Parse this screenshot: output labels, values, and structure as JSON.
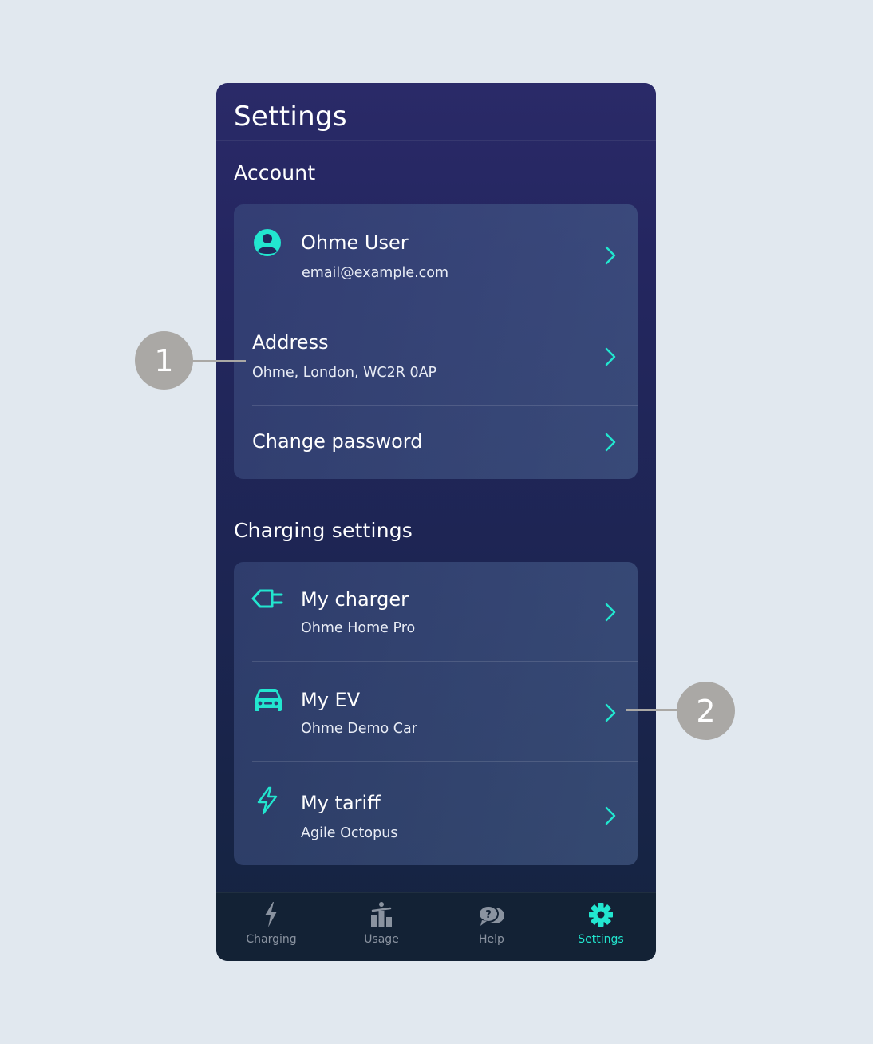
{
  "header": {
    "title": "Settings"
  },
  "account": {
    "section_title": "Account",
    "user": {
      "name": "Ohme User",
      "email": "email@example.com",
      "icon": "user-circle-icon"
    },
    "address": {
      "label": "Address",
      "value": "Ohme, London, WC2R 0AP"
    },
    "password": {
      "label": "Change password"
    }
  },
  "charging": {
    "section_title": "Charging settings",
    "charger": {
      "label": "My charger",
      "value": "Ohme Home Pro",
      "icon": "plug-icon"
    },
    "ev": {
      "label": "My EV",
      "value": "Ohme Demo Car",
      "icon": "car-icon"
    },
    "tariff": {
      "label": "My tariff",
      "value": "Agile Octopus",
      "icon": "lightning-icon"
    }
  },
  "tabs": [
    {
      "label": "Charging",
      "icon": "lightning-icon",
      "active": false
    },
    {
      "label": "Usage",
      "icon": "bar-chart-icon",
      "active": false
    },
    {
      "label": "Help",
      "icon": "chat-bubbles-icon",
      "active": false
    },
    {
      "label": "Settings",
      "icon": "gear-icon",
      "active": true
    }
  ],
  "callouts": [
    "1",
    "2"
  ],
  "colors": {
    "accent": "#22e6cf",
    "background": "#e1e8ef",
    "callout": "#aaa8a5",
    "tab_inactive": "#8a93a0"
  }
}
